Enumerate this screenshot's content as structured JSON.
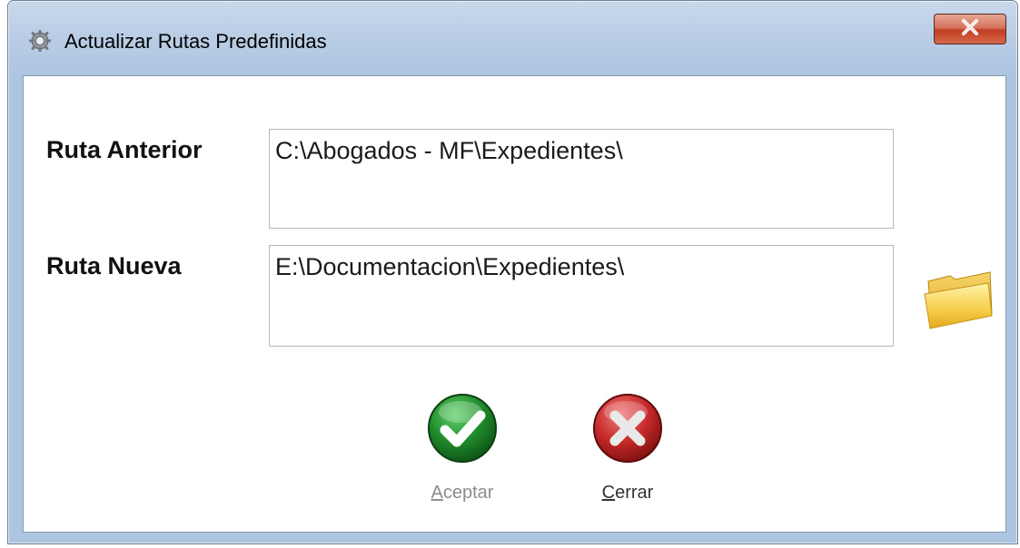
{
  "window": {
    "title": "Actualizar Rutas Predefinidas",
    "title_icon": "gear-icon",
    "close_icon": "close-x-icon"
  },
  "form": {
    "old_path_label": "Ruta Anterior",
    "old_path_value": "C:\\Abogados - MF\\Expedientes\\",
    "new_path_label": "Ruta Nueva",
    "new_path_value": "E:\\Documentacion\\Expedientes\\",
    "browse_icon": "folder-icon"
  },
  "buttons": {
    "accept": {
      "mnemonic": "A",
      "rest": "ceptar",
      "icon": "green-check-icon",
      "enabled": false
    },
    "close": {
      "mnemonic": "C",
      "rest": "errar",
      "icon": "red-x-icon",
      "enabled": true
    }
  },
  "colors": {
    "accept_green": "#1f8a2a",
    "close_red": "#c62828",
    "folder_yellow": "#f3c640",
    "titlebar_close": "#c9462a"
  }
}
